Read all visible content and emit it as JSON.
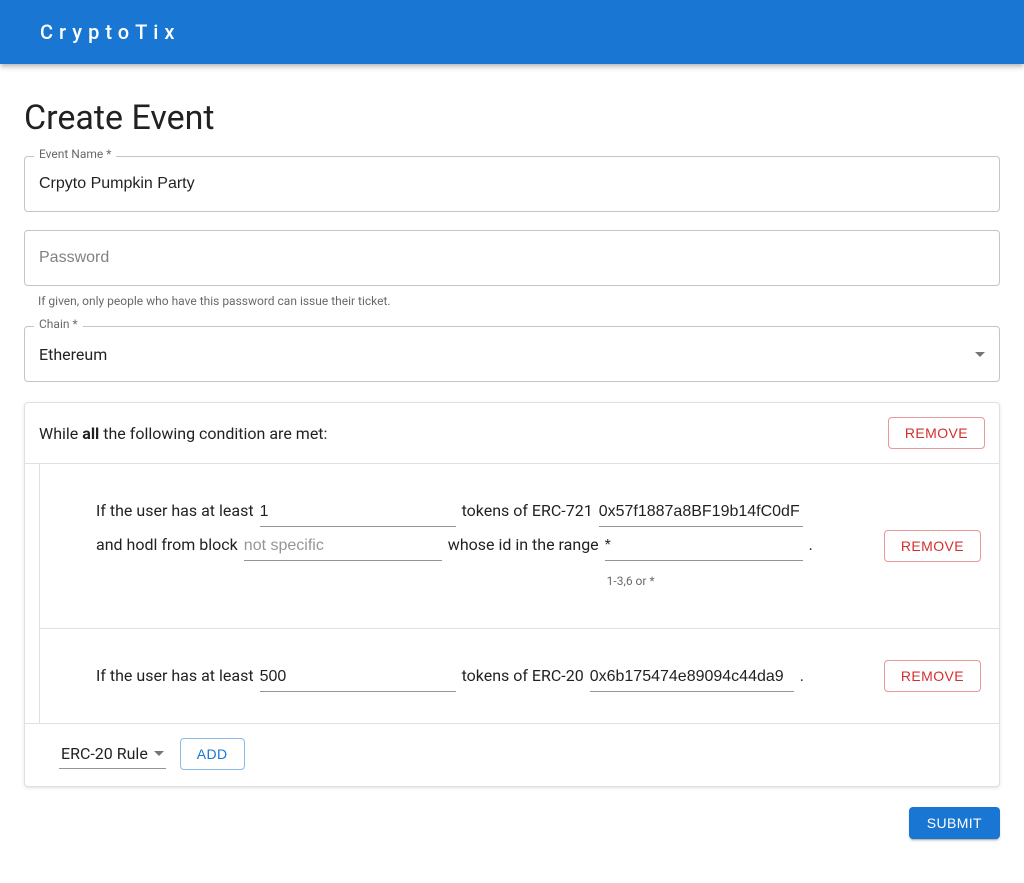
{
  "header": {
    "brand": "CryptoTix"
  },
  "page": {
    "title": "Create Event"
  },
  "form": {
    "event_name": {
      "label": "Event Name *",
      "value": "Crpyto Pumpkin Party"
    },
    "password": {
      "placeholder": "Password",
      "helper": "If given, only people who have this password can issue their ticket."
    },
    "chain": {
      "label": "Chain *",
      "value": "Ethereum"
    }
  },
  "rules_panel": {
    "condition_prefix": "While ",
    "condition_bold": "all",
    "condition_suffix": " the following condition are met:",
    "remove_label": "REMOVE",
    "rules": [
      {
        "type": "erc721",
        "prefix": "If the user has at least ",
        "amount": "1",
        "mid": " tokens of ERC-721 ",
        "address": "0x57f1887a8BF19b14fC0dF",
        "line2_prefix": "and hodl from block ",
        "block_placeholder": "not specific",
        "block_value": "",
        "line2_mid": " whose id in the range ",
        "idrange": "*",
        "idrange_helper": "1-3,6 or *",
        "period": ".",
        "remove_label": "REMOVE"
      },
      {
        "type": "erc20",
        "prefix": "If the user has at least ",
        "amount": "500",
        "mid": " tokens of ERC-20 ",
        "address": "0x6b175474e89094c44da9",
        "period": " .",
        "remove_label": "REMOVE"
      }
    ],
    "add": {
      "rule_type_value": "ERC-20 Rule",
      "add_label": "ADD"
    }
  },
  "actions": {
    "submit_label": "SUBMIT"
  }
}
